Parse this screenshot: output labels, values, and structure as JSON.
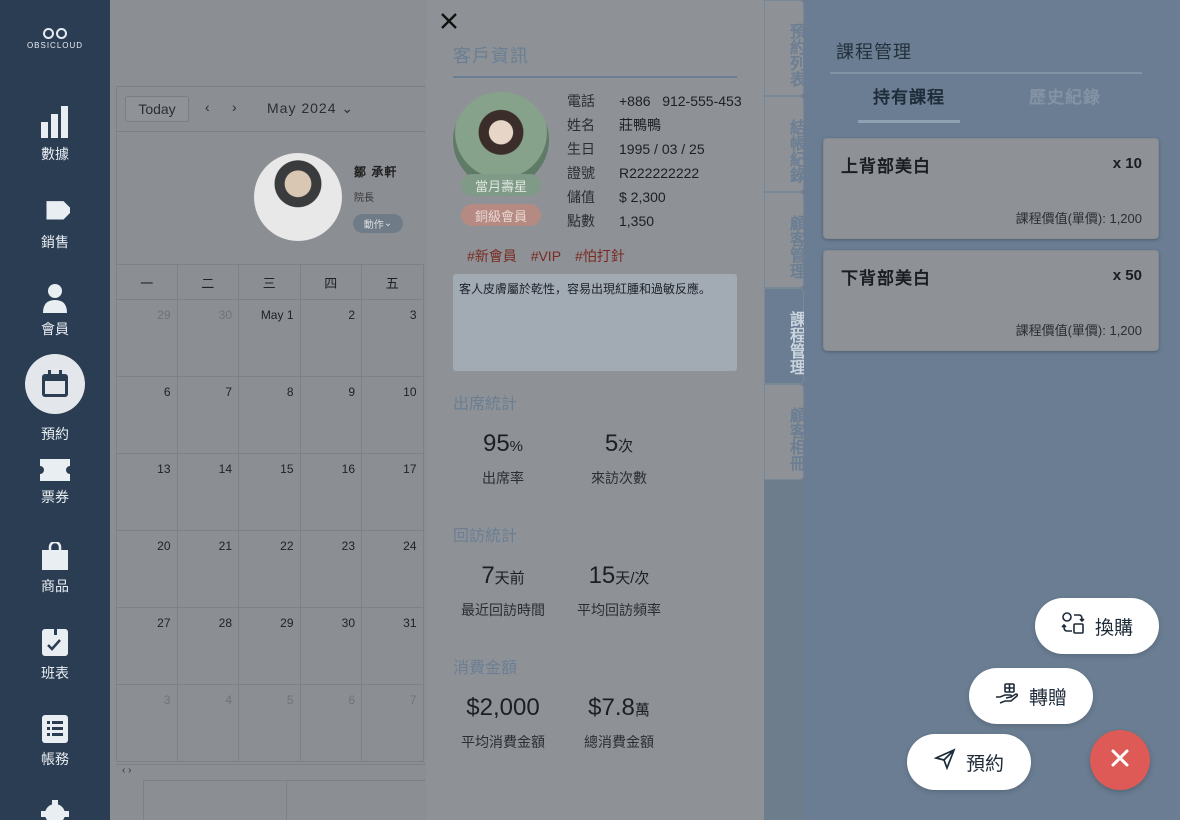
{
  "brand": {
    "name": "OBSICLOUD"
  },
  "nav": {
    "items": [
      {
        "label": "數據",
        "icon": "bar-chart-icon"
      },
      {
        "label": "銷售",
        "icon": "tag-icon"
      },
      {
        "label": "會員",
        "icon": "user-icon"
      },
      {
        "label": "預約",
        "icon": "calendar-icon",
        "active": true
      },
      {
        "label": "票券",
        "icon": "ticket-icon"
      },
      {
        "label": "商品",
        "icon": "shopping-bag-icon"
      },
      {
        "label": "班表",
        "icon": "schedule-icon"
      },
      {
        "label": "帳務",
        "icon": "ledger-icon"
      }
    ]
  },
  "calendar": {
    "today_label": "Today",
    "month_label": "May 2024",
    "staff": {
      "name": "鄒 承軒",
      "role": "院長",
      "action": "動作"
    },
    "weekdays": [
      "一",
      "二",
      "三",
      "四",
      "五"
    ],
    "weeks": [
      [
        "29",
        "30",
        "May 1",
        "2",
        "3"
      ],
      [
        "6",
        "7",
        "8",
        "9",
        "10"
      ],
      [
        "13",
        "14",
        "15",
        "16",
        "17"
      ],
      [
        "20",
        "21",
        "22",
        "23",
        "24"
      ],
      [
        "27",
        "28",
        "29",
        "30",
        "31"
      ],
      [
        "3",
        "4",
        "5",
        "6",
        "7"
      ]
    ],
    "footer_arrows": "‹ ›"
  },
  "customer": {
    "title": "客戶資訊",
    "birthday_tag": "當月壽星",
    "level_tag": "銅級會員",
    "fields": [
      {
        "k": "電話",
        "v": "+886   912-555-453"
      },
      {
        "k": "姓名",
        "v": "莊鴨鴨"
      },
      {
        "k": "生日",
        "v": "1995 / 03 / 25"
      },
      {
        "k": "證號",
        "v": "R222222222"
      },
      {
        "k": "儲值",
        "v": "$ 2,300"
      },
      {
        "k": "點數",
        "v": "1,350"
      }
    ],
    "tags": [
      "#新會員",
      "#VIP",
      "#怕打針"
    ],
    "note": "客人皮膚屬於乾性，容易出現紅腫和過敏反應。",
    "attendance": {
      "title": "出席統計",
      "rate_value": "95",
      "rate_unit": "%",
      "rate_label": "出席率",
      "visits_value": "5",
      "visits_unit": "次",
      "visits_label": "來訪次數"
    },
    "revisit": {
      "title": "回訪統計",
      "last_value": "7",
      "last_unit": "天前",
      "last_label": "最近回訪時間",
      "freq_value": "15",
      "freq_unit": "天/次",
      "freq_label": "平均回訪頻率"
    },
    "spending": {
      "title": "消費金額",
      "avg_value": "$2,000",
      "avg_label": "平均消費金額",
      "total_value": "$7.8",
      "total_unit": "萬",
      "total_label": "總消費金額"
    }
  },
  "vtabs": [
    {
      "label": "預約列表"
    },
    {
      "label": "結帳紀錄"
    },
    {
      "label": "顧客管理"
    },
    {
      "label": "課程管理",
      "active": true
    },
    {
      "label": "顧客相冊"
    }
  ],
  "courses": {
    "title": "課程管理",
    "tab_owned": "持有課程",
    "tab_history": "歷史紀錄",
    "items": [
      {
        "name": "上背部美白",
        "qty": "x 10",
        "price": "課程價值(單價): 1,200"
      },
      {
        "name": "下背部美白",
        "qty": "x 50",
        "price": "課程價值(單價): 1,200"
      }
    ]
  },
  "actions": {
    "exchange": "換購",
    "gift": "轉贈",
    "book": "預約"
  },
  "colors": {
    "nav_bg": "#2b3d52",
    "accent_blue": "#6b7e93",
    "close_red": "#dd5a57"
  }
}
